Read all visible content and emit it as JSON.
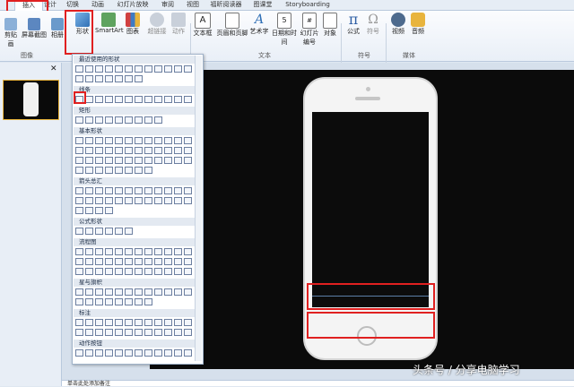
{
  "tabs": [
    {
      "label": "插入",
      "active": true
    },
    {
      "label": "设计"
    },
    {
      "label": "切换"
    },
    {
      "label": "动画"
    },
    {
      "label": "幻灯片放映"
    },
    {
      "label": "审阅"
    },
    {
      "label": "视图"
    },
    {
      "label": "福昕阅读器"
    },
    {
      "label": "图课堂"
    },
    {
      "label": "Storyboarding"
    }
  ],
  "ribbon": {
    "buttons": [
      "剪贴画",
      "屏幕截图",
      "相册",
      "形状",
      "SmartArt",
      "图表",
      "超链接",
      "动作",
      "文本框",
      "页眉和页脚",
      "艺术字",
      "日期和时间",
      "幻灯片编号",
      "对象",
      "公式",
      "符号",
      "视频",
      "音频"
    ],
    "groups": [
      "图像",
      "文本",
      "符号",
      "媒体"
    ]
  },
  "shapes_panel": {
    "sections": [
      "最近使用的形状",
      "线条",
      "矩形",
      "基本形状",
      "箭头总汇",
      "公式形状",
      "流程图",
      "星与旗帜",
      "标注",
      "动作按钮"
    ]
  },
  "notes": {
    "placeholder": "单击此处添加备注"
  },
  "watermark": "头条号 / 分享电脑学习"
}
